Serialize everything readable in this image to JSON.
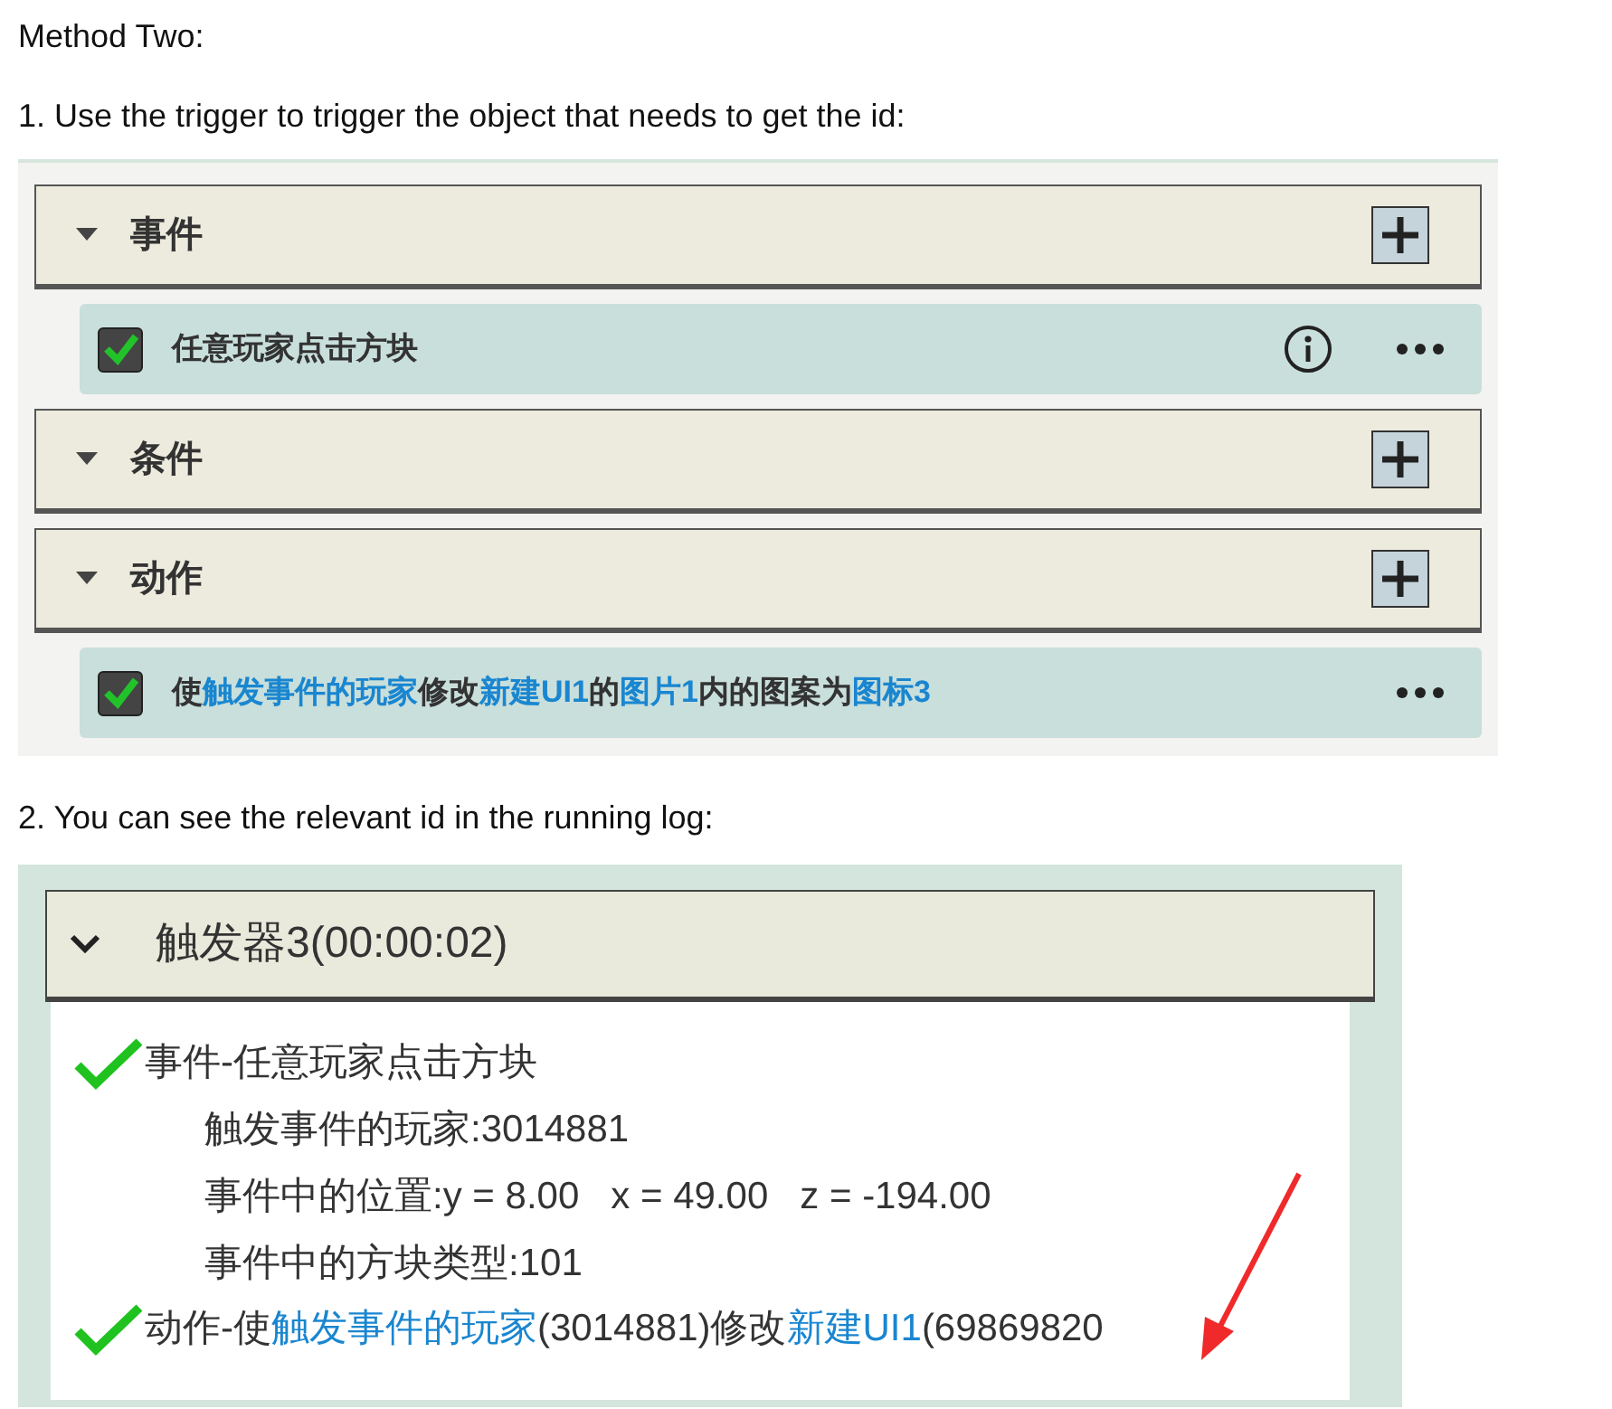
{
  "heading": "Method Two:",
  "step_1": "1. Use the trigger to trigger the object that needs to get the id:",
  "trigger_editor": {
    "sections": [
      {
        "title": "事件",
        "expanded": true,
        "items": [
          {
            "checked": true,
            "info_button": true,
            "segments": [
              {
                "kind": "plain",
                "text": "任意玩家点击方块"
              }
            ]
          }
        ]
      },
      {
        "title": "条件",
        "expanded": true
      },
      {
        "title": "动作",
        "expanded": true,
        "items": [
          {
            "checked": true,
            "segments": [
              {
                "kind": "plain",
                "text": "使"
              },
              {
                "kind": "param",
                "text": "触发事件的玩家"
              },
              {
                "kind": "plain",
                "text": "修改"
              },
              {
                "kind": "param",
                "text": "新建UI1"
              },
              {
                "kind": "plain",
                "text": "的"
              },
              {
                "kind": "param",
                "text": "图片1"
              },
              {
                "kind": "plain",
                "text": "内的图案为"
              },
              {
                "kind": "param",
                "text": "图标3"
              }
            ]
          }
        ]
      }
    ]
  },
  "step_2": "2. You can see the relevant id in the running log:",
  "run_log": {
    "title": "触发器3(00:00:02)",
    "expanded": true,
    "entries": [
      {
        "success": true,
        "segments": [
          {
            "kind": "plain",
            "text": "事件-任意玩家点击方块"
          }
        ],
        "details": [
          "触发事件的玩家:3014881",
          "事件中的位置:y = 8.00   x = 49.00   z = -194.00",
          "事件中的方块类型:101"
        ]
      },
      {
        "success": true,
        "segments": [
          {
            "kind": "plain",
            "text": "动作-使"
          },
          {
            "kind": "param",
            "text": "触发事件的玩家"
          },
          {
            "kind": "plain",
            "text": "(3014881)修改"
          },
          {
            "kind": "param",
            "text": "新建UI1"
          },
          {
            "kind": "plain",
            "text": "(69869820"
          }
        ]
      }
    ]
  }
}
